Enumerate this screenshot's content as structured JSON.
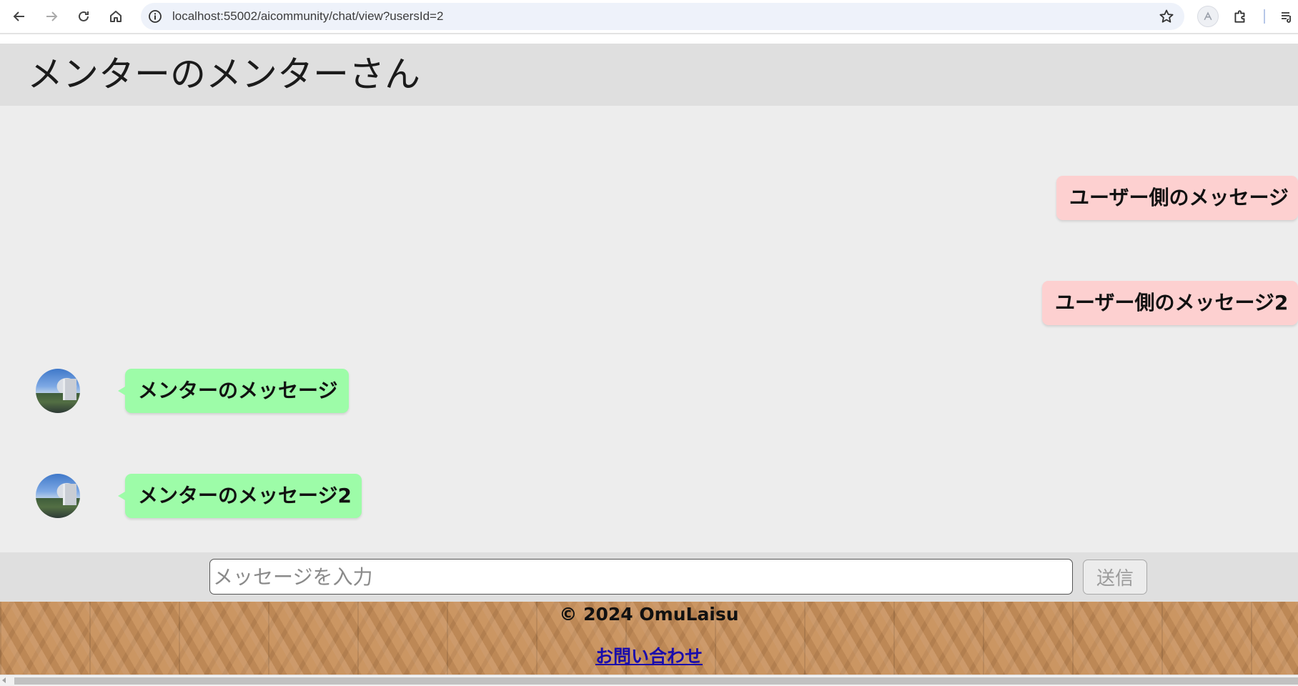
{
  "browser": {
    "url": "localhost:55002/aicommunity/chat/view?usersId=2"
  },
  "header": {
    "title": "メンターのメンターさん"
  },
  "messages": {
    "user_1": "ユーザー側のメッセージ",
    "user_2": "ユーザー側のメッセージ2",
    "mentor_1": "メンターのメッセージ",
    "mentor_2": "メンターのメッセージ2"
  },
  "composer": {
    "placeholder": "メッセージを入力",
    "send_label": "送信"
  },
  "footer": {
    "copyright": "© 2024 OmuLaisu",
    "contact_label": "お問い合わせ"
  },
  "colors": {
    "user_bubble": "#fdd0d0",
    "mentor_bubble": "#9dfca8",
    "header_bg": "#dfdfdf",
    "chat_bg": "#ededed",
    "link": "#1a0dab"
  }
}
